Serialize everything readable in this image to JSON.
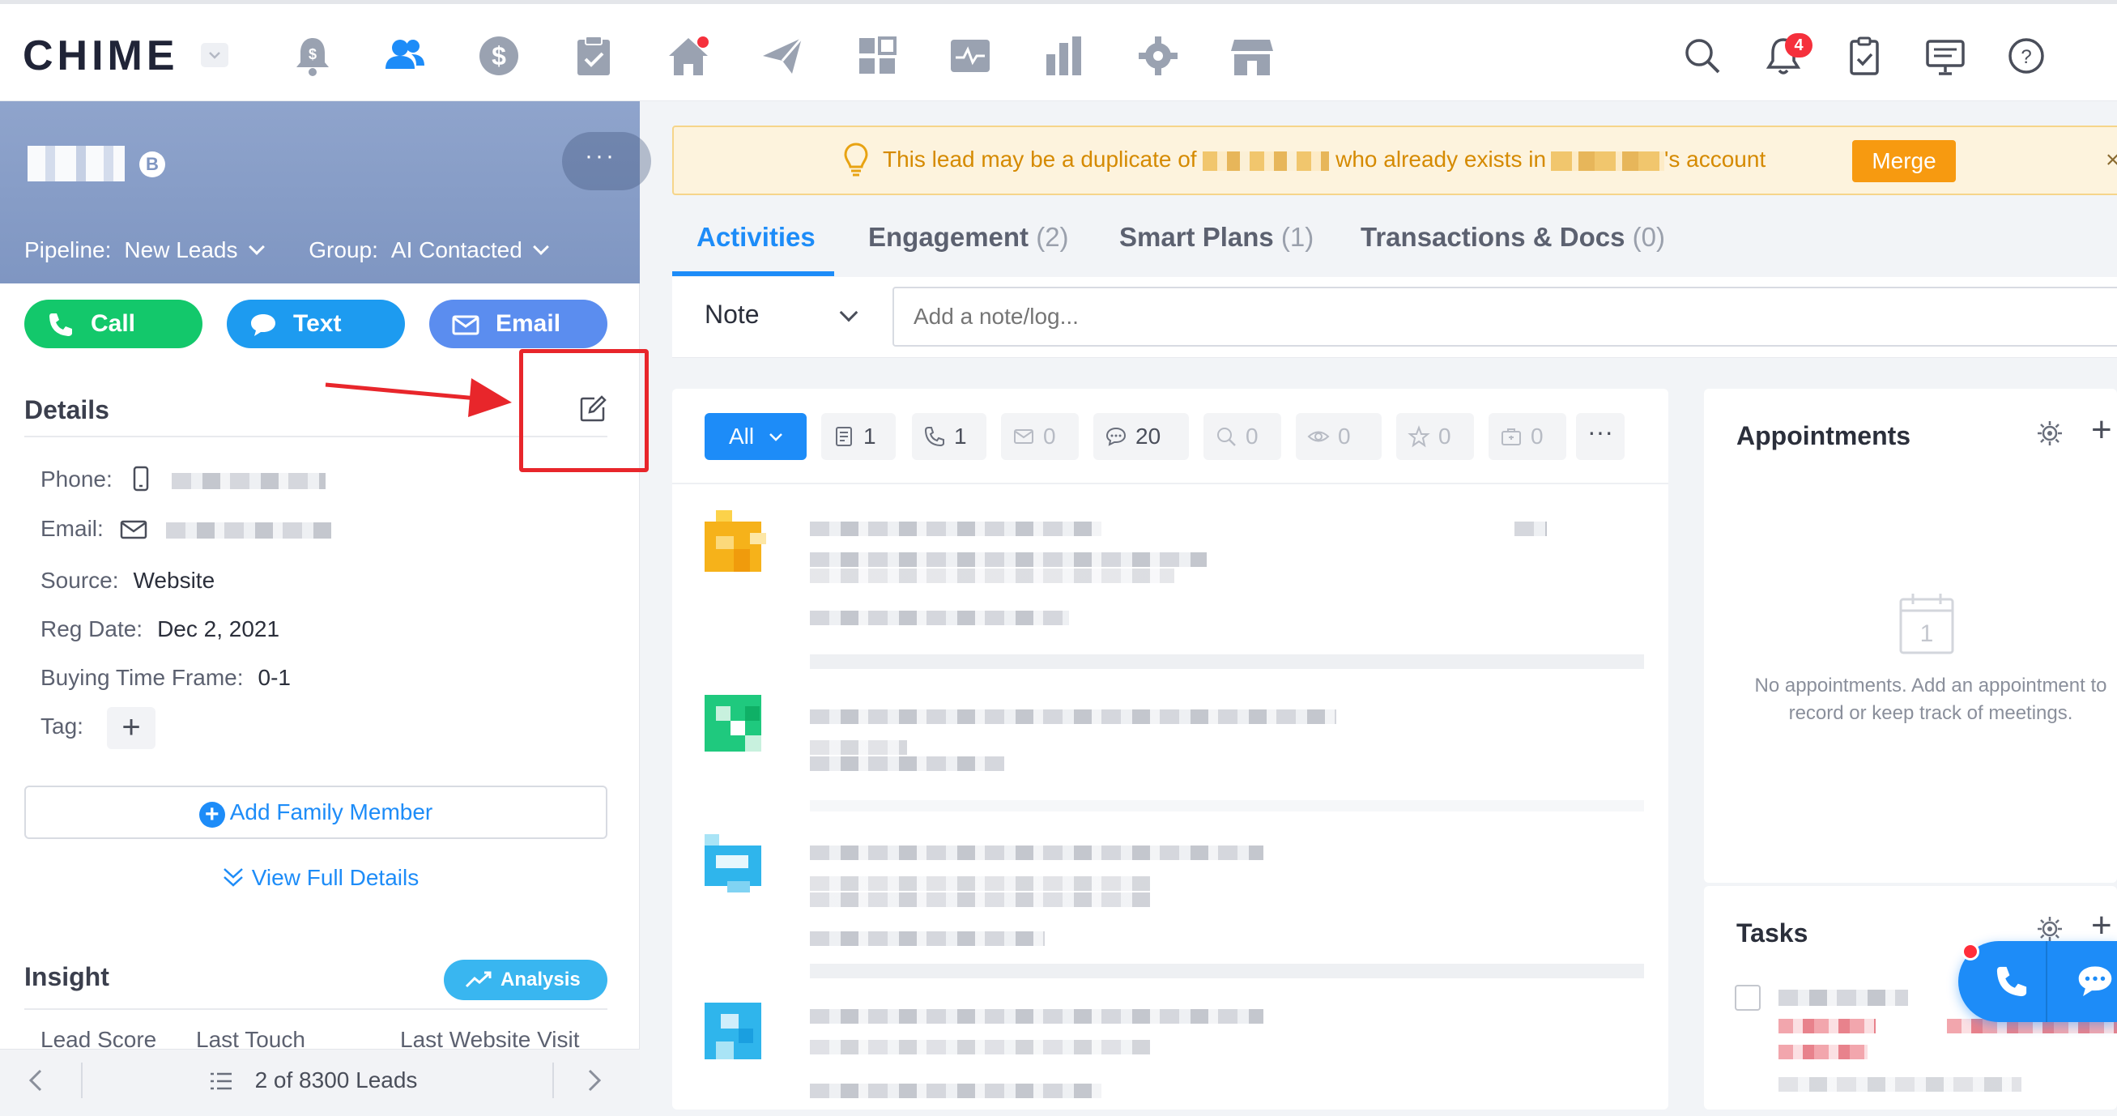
{
  "app": {
    "logo": "CHIME",
    "notification_count": "4"
  },
  "lead": {
    "badge": "B",
    "more": "···",
    "pipeline_label": "Pipeline:",
    "pipeline_value": "New Leads",
    "group_label": "Group:",
    "group_value": "AI Contacted"
  },
  "actions": {
    "call": "Call",
    "text": "Text",
    "email": "Email"
  },
  "details": {
    "title": "Details",
    "phone_label": "Phone:",
    "email_label": "Email:",
    "source_label": "Source:",
    "source_value": "Website",
    "reg_date_label": "Reg Date:",
    "reg_date_value": "Dec 2, 2021",
    "buying_label": "Buying Time Frame:",
    "buying_value": "0-1",
    "tag_label": "Tag:",
    "tag_add": "+",
    "add_family": "Add Family Member",
    "view_full": "View Full Details"
  },
  "insight": {
    "title": "Insight",
    "analysis": "Analysis",
    "col_lead_score": "Lead Score",
    "col_last_touch": "Last Touch",
    "col_last_visit": "Last Website Visit"
  },
  "pager": {
    "text": "2 of 8300 Leads"
  },
  "banner": {
    "text_before": "This lead may be a duplicate of",
    "text_middle": "who already exists in",
    "text_after": "'s account",
    "merge": "Merge",
    "close": "×"
  },
  "tabs": [
    {
      "label": "Activities",
      "count": ""
    },
    {
      "label": "Engagement",
      "count": "(2)"
    },
    {
      "label": "Smart Plans",
      "count": "(1)"
    },
    {
      "label": "Transactions & Docs",
      "count": "(0)"
    }
  ],
  "note": {
    "type": "Note",
    "placeholder": "Add a note/log..."
  },
  "filters": {
    "all": "All",
    "notes": "1",
    "calls": "1",
    "emails": "0",
    "texts": "20",
    "searches": "0",
    "views": "0",
    "favorites": "0",
    "transactions": "0",
    "more": "···"
  },
  "appointments": {
    "title": "Appointments",
    "calendar_day": "1",
    "empty": "No appointments. Add an appointment to record or keep track of meetings."
  },
  "tasks": {
    "title": "Tasks"
  },
  "colors": {
    "accent": "#1d8cf8",
    "call": "#13c86b",
    "text": "#1d9bf0",
    "email": "#5b8def",
    "merge": "#f79a10",
    "annotation": "#e8262b"
  }
}
